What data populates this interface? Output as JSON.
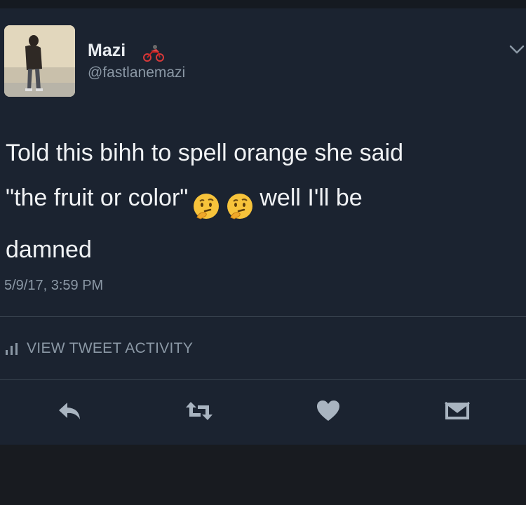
{
  "tweet": {
    "author_name": "Mazi",
    "handle": "@fastlanemazi",
    "text_line1": "Told this bihh to spell orange she said",
    "text_line2a": "\"the fruit or color\"",
    "text_line2b": "well I'll be",
    "text_line3": "damned",
    "timestamp": "5/9/17, 3:59 PM",
    "activity_label": "VIEW TWEET ACTIVITY"
  },
  "icons": {
    "name_badge": "motorcycle-emoji-icon",
    "thinking": "thinking-face-emoji-icon",
    "menu": "chevron-down-icon",
    "activity": "bar-chart-icon",
    "reply": "reply-icon",
    "retweet": "retweet-icon",
    "like": "heart-icon",
    "message": "envelope-icon"
  },
  "colors": {
    "background": "#1b2330",
    "text": "#f0f2f4",
    "secondary": "#8b98a5",
    "action_icon": "#a9b4c0"
  }
}
